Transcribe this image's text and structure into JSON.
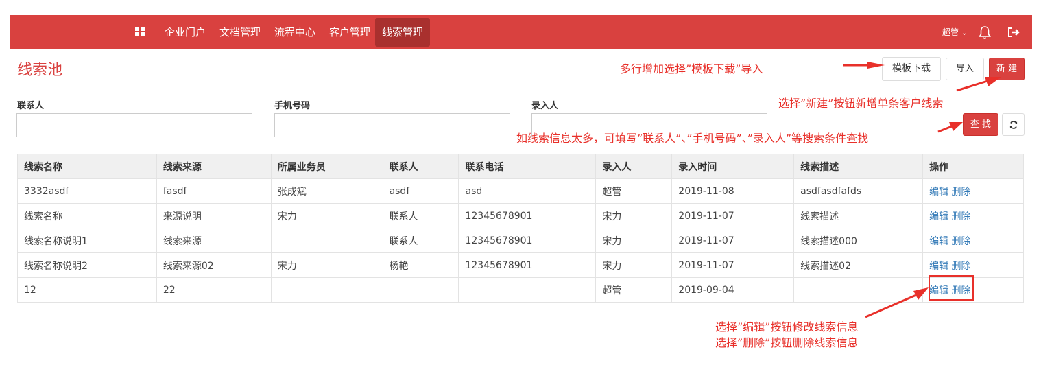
{
  "nav": {
    "items": [
      "企业门户",
      "文档管理",
      "流程中心",
      "客户管理",
      "线索管理"
    ],
    "active_index": 4,
    "user_label": "超管",
    "icons": {
      "apps": "grid-icon",
      "notify": "bell-icon",
      "logout": "logout-icon"
    },
    "color": "#d9413f"
  },
  "page": {
    "title": "线索池"
  },
  "toolbar": {
    "template_download": "模板下载",
    "import": "导入",
    "new": "新 建",
    "search": "查 找",
    "refresh_icon": "refresh-icon"
  },
  "filters": [
    {
      "label": "联系人",
      "value": ""
    },
    {
      "label": "手机号码",
      "value": ""
    },
    {
      "label": "录入人",
      "value": ""
    }
  ],
  "table": {
    "headers": [
      "线索名称",
      "线索来源",
      "所属业务员",
      "联系人",
      "联系电话",
      "录入人",
      "录入时间",
      "线索描述",
      "操作"
    ],
    "rows": [
      [
        "3332asdf",
        "fasdf",
        "张成斌",
        "asdf",
        "asd",
        "超管",
        "2019-11-08",
        "asdfasdfafds"
      ],
      [
        "线索名称",
        "来源说明",
        "宋力",
        "联系人",
        "12345678901",
        "宋力",
        "2019-11-07",
        "线索描述"
      ],
      [
        "线索名称说明1",
        "线索来源",
        "",
        "联系人",
        "12345678901",
        "宋力",
        "2019-11-07",
        "线索描述000"
      ],
      [
        "线索名称说明2",
        "线索来源02",
        "宋力",
        "杨艳",
        "12345678901",
        "宋力",
        "2019-11-07",
        "线索描述02"
      ],
      [
        "12",
        "22",
        "",
        "",
        "",
        "超管",
        "2019-09-04",
        ""
      ]
    ],
    "actions": {
      "edit": "编辑",
      "delete": "删除"
    }
  },
  "annotations": {
    "template": "多行增加选择”模板下载”导入",
    "new_btn": "选择”新建”按钮新增单条客户线索",
    "search": "如线索信息太多，可填写”联系人”、”手机号码”、”录入人”等搜索条件查找",
    "edit": "选择”编辑”按钮修改线索信息",
    "delete": "选择”删除”按钮删除线索信息",
    "color": "#e8302a"
  }
}
